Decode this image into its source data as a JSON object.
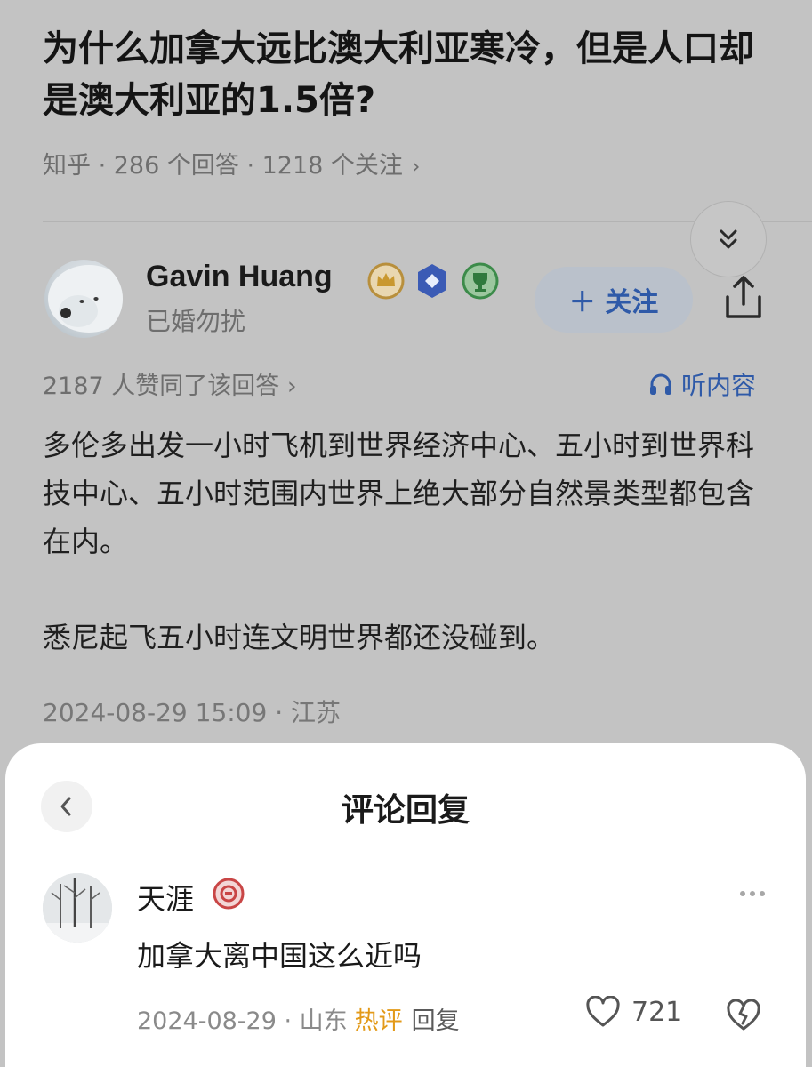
{
  "question": {
    "title": "为什么加拿大远比澳大利亚寒冷，但是人口却是澳大利亚的1.5倍?",
    "meta": "知乎 · 286 个回答 · 1218 个关注",
    "meta_chevron": "›"
  },
  "answer": {
    "author_name": "Gavin Huang",
    "author_subtitle": "已婚勿扰",
    "follow_label": "＋ 关注",
    "upvote_text": "2187 人赞同了该回答 ›",
    "listen_label": "听内容",
    "paragraphs": [
      "多伦多出发一小时飞机到世界经济中心、五小时到世界科技中心、五小时范围内世界上绝大部分自然景类型都包含在内。",
      "悉尼起飞五小时连文明世界都还没碰到。"
    ],
    "time_location": "2024-08-29 15:09 · 江苏",
    "icons": [
      "double-chevron-down-icon",
      "crown-badge-icon",
      "diamond-badge-icon",
      "trophy-badge-icon",
      "share-icon",
      "headphones-icon"
    ]
  },
  "comment_sheet": {
    "title": "评论回复",
    "back_icon": "chevron-left-icon",
    "comment": {
      "user_name": "天涯",
      "text": "加拿大离中国这么近吗",
      "date_location": "2024-08-29 · 山东",
      "hot_label": "热评",
      "reply_label": "回复",
      "like_count": "721",
      "icons": [
        "user-badge-icon",
        "more-dots-icon",
        "heart-icon",
        "dislike-heart-icon"
      ]
    }
  },
  "colors": {
    "overlay_bg": "#c3c3c3",
    "link_blue": "#2f5aa8",
    "hot_orange": "#e39a19",
    "sheet_bg": "#ffffff"
  }
}
